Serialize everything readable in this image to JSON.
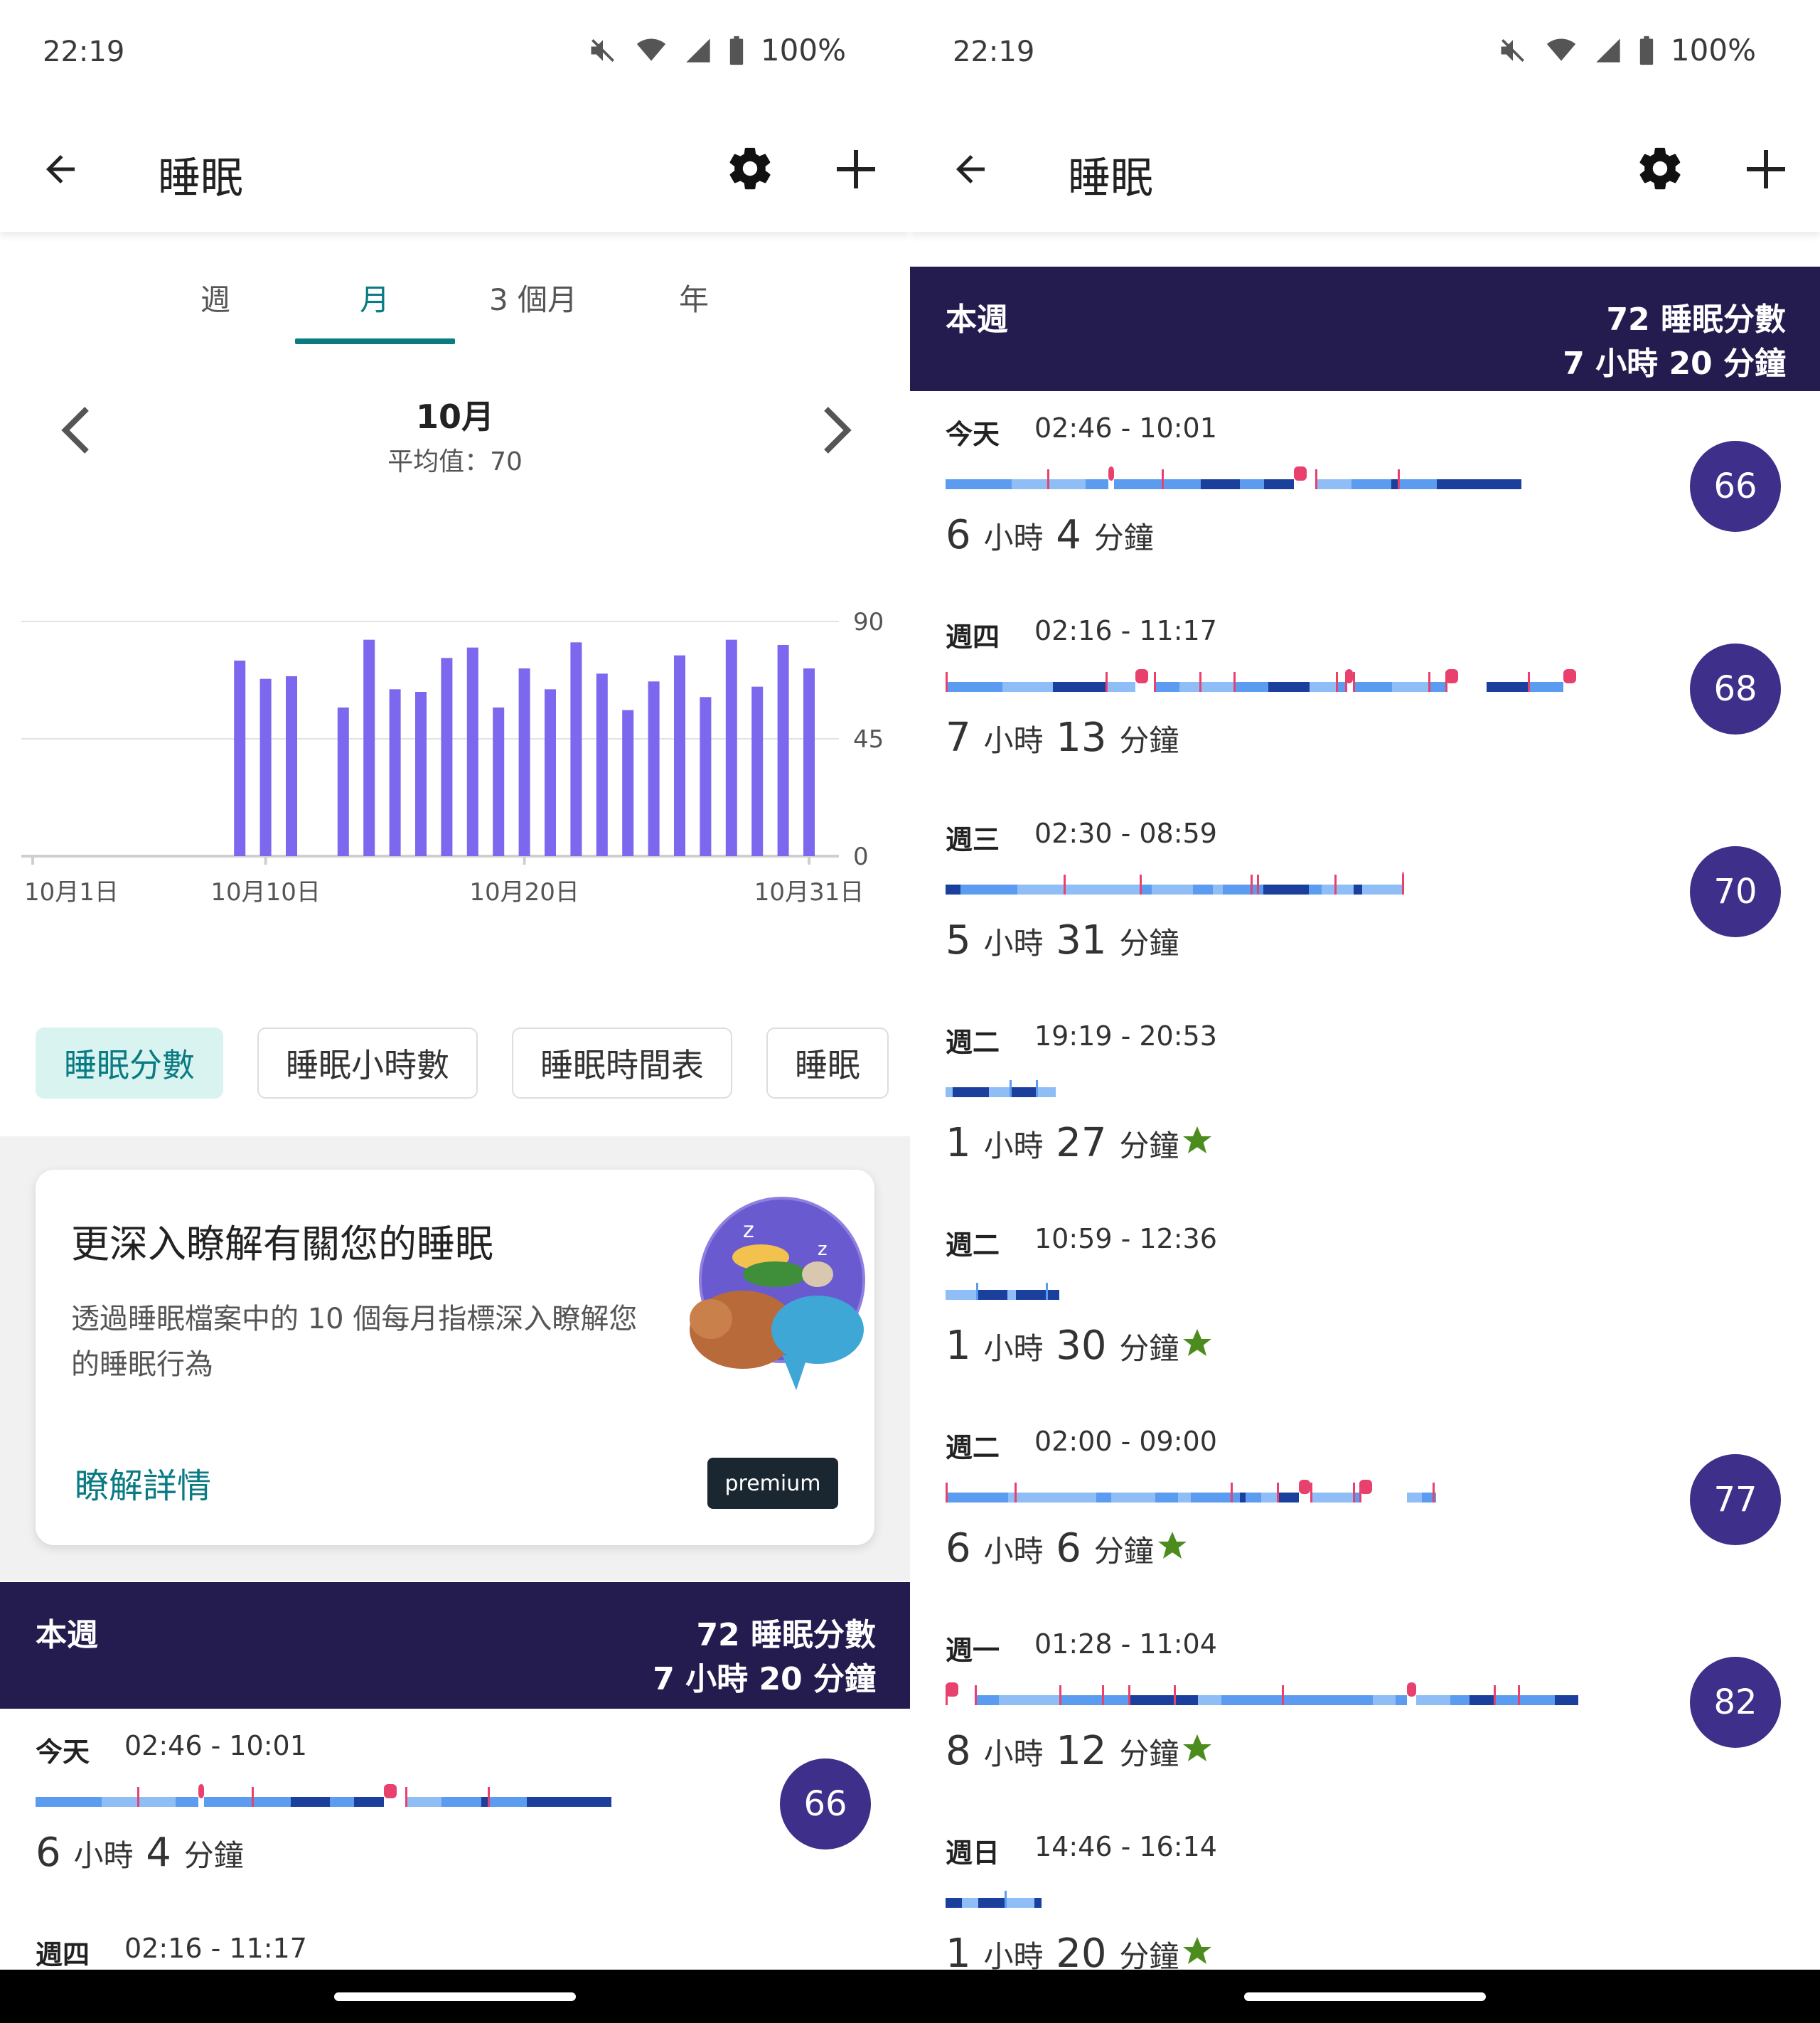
{
  "left": {
    "status": {
      "time": "22:19",
      "battery": "100%"
    },
    "appbar": {
      "title": "睡眠"
    },
    "tabs": [
      "週",
      "月",
      "3 個月",
      "年"
    ],
    "active_tab": "月",
    "month_nav": {
      "month": "10月",
      "average": "平均值：70"
    },
    "chart_data": {
      "type": "bar",
      "title": "",
      "x_tick_labels": [
        "10月1日",
        "10月10日",
        "10月20日",
        "10月31日"
      ],
      "y_tick_labels": [
        "90",
        "45",
        "0"
      ],
      "ylim": [
        0,
        90
      ],
      "categories": [
        "1",
        "2",
        "3",
        "4",
        "5",
        "6",
        "7",
        "8",
        "9",
        "10",
        "11",
        "12",
        "13",
        "14",
        "15",
        "16",
        "17",
        "18",
        "19",
        "20",
        "21",
        "22",
        "23",
        "24",
        "25",
        "26",
        "27",
        "28",
        "29",
        "30",
        "31"
      ],
      "values": [
        null,
        null,
        null,
        null,
        null,
        null,
        null,
        null,
        75,
        68,
        69,
        null,
        57,
        83,
        64,
        63,
        76,
        80,
        57,
        72,
        64,
        82,
        70,
        56,
        67,
        77,
        61,
        83,
        65,
        81,
        72
      ],
      "bar_color": "#7b68ee",
      "grid": true
    },
    "chips": [
      "睡眠分數",
      "睡眠小時數",
      "睡眠時間表",
      "睡眠"
    ],
    "card": {
      "title": "更深入瞭解有關您的睡眠",
      "description": "透過睡眠檔案中的 10 個每月指標深入瞭解您的睡眠行為",
      "link": "瞭解詳情",
      "badge": "premium"
    },
    "week_header": {
      "label": "本週",
      "score": "72 睡眠分數",
      "duration": "7 小時 20 分鐘"
    },
    "entries": [
      {
        "day": "今天",
        "range": "02:46 - 10:01",
        "h": "6",
        "m": "4",
        "score": "66"
      },
      {
        "day": "週四",
        "range": "02:16 - 11:17",
        "h": "",
        "m": "",
        "score": ""
      }
    ]
  },
  "right": {
    "status": {
      "time": "22:19",
      "battery": "100%"
    },
    "appbar": {
      "title": "睡眠"
    },
    "week_header": {
      "label": "本週",
      "score": "72 睡眠分數",
      "duration": "7 小時 20 分鐘"
    },
    "entries": [
      {
        "day": "今天",
        "range": "02:46 - 10:01",
        "h": "6",
        "m": "4",
        "score": "66",
        "star": false
      },
      {
        "day": "週四",
        "range": "02:16 - 11:17",
        "h": "7",
        "m": "13",
        "score": "68",
        "star": false
      },
      {
        "day": "週三",
        "range": "02:30 - 08:59",
        "h": "5",
        "m": "31",
        "score": "70",
        "star": false
      },
      {
        "day": "週二",
        "range": "19:19 - 20:53",
        "h": "1",
        "m": "27",
        "score": "",
        "star": true
      },
      {
        "day": "週二",
        "range": "10:59 - 12:36",
        "h": "1",
        "m": "30",
        "score": "",
        "star": true
      },
      {
        "day": "週二",
        "range": "02:00 - 09:00",
        "h": "6",
        "m": "6",
        "score": "77",
        "star": true
      },
      {
        "day": "週一",
        "range": "01:28 - 11:04",
        "h": "8",
        "m": "12",
        "score": "82",
        "star": true
      },
      {
        "day": "週日",
        "range": "14:46 - 16:14",
        "h": "1",
        "m": "20",
        "score": "",
        "star": true
      }
    ],
    "units": {
      "hour": "小時",
      "minute": "分鐘"
    }
  },
  "colors": {
    "accent": "#0a7b83",
    "header": "#241c4f",
    "score_circle": "#3d2f8a",
    "bar": "#7b68ee",
    "star": "#4c8c1e",
    "awake": "#e8416d",
    "light": "#5b9cf0",
    "deep": "#1b3f9c"
  }
}
